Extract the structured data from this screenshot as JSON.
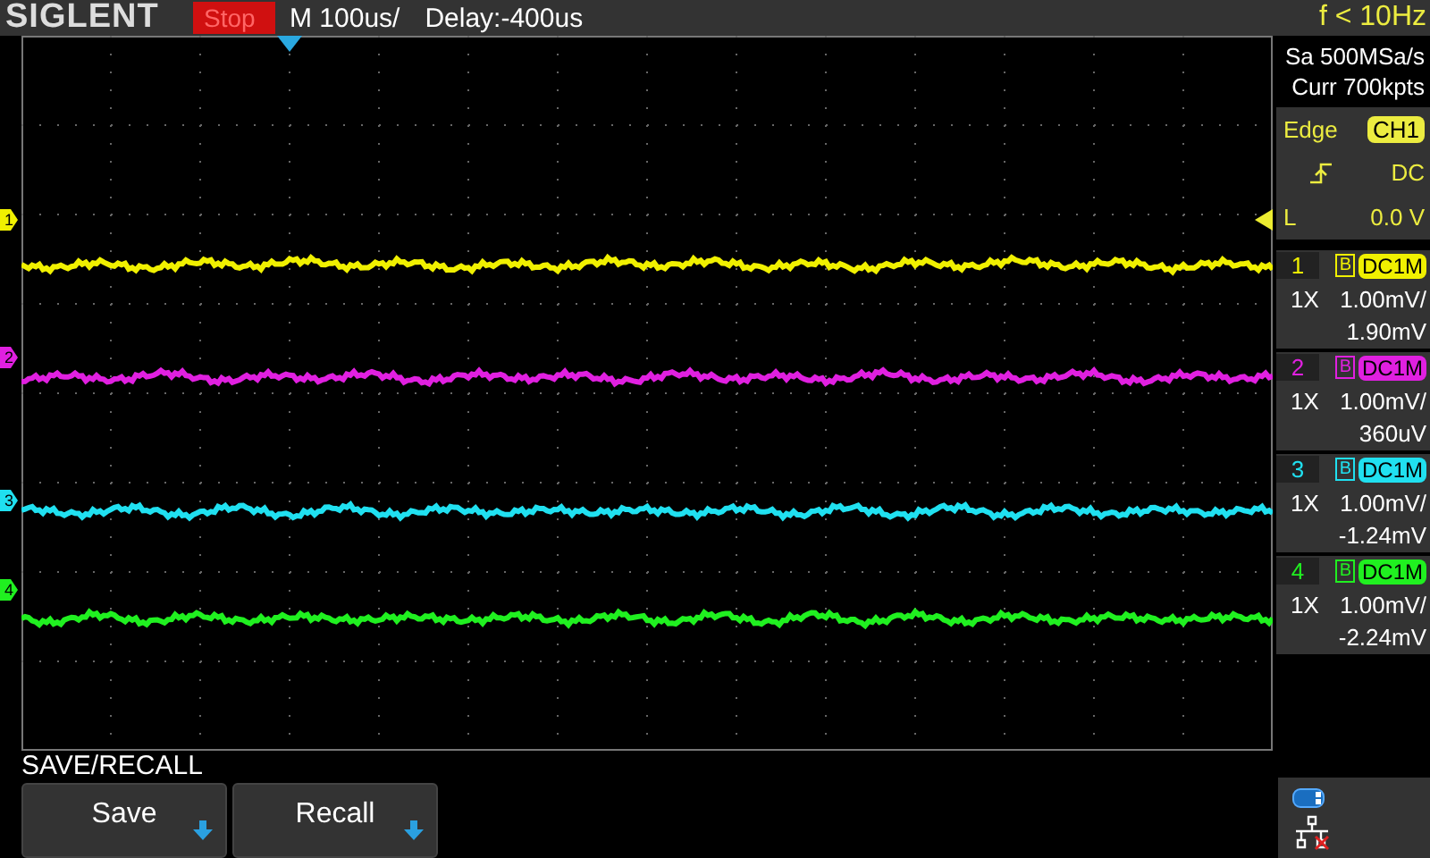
{
  "header": {
    "brand": "SIGLENT",
    "run_state": "Stop",
    "timebase": "M 100us/",
    "delay": "Delay:-400us",
    "frequency": "f < 10Hz"
  },
  "acquisition": {
    "sample_rate": "Sa 500MSa/s",
    "memory_depth": "Curr 700kpts"
  },
  "trigger": {
    "type": "Edge",
    "source": "CH1",
    "coupling": "DC",
    "level_label": "L",
    "level_value": "0.0 V"
  },
  "channels": [
    {
      "number": "1",
      "marker": "1",
      "color": "#f0f000",
      "bandwidth_mark": "B",
      "coupling": "DC1M",
      "probe": "1X",
      "scale": "1.00mV/",
      "offset": "1.90mV"
    },
    {
      "number": "2",
      "marker": "2",
      "color": "#e020e0",
      "bandwidth_mark": "B",
      "coupling": "DC1M",
      "probe": "1X",
      "scale": "1.00mV/",
      "offset": "360uV"
    },
    {
      "number": "3",
      "marker": "3",
      "color": "#20e0f0",
      "bandwidth_mark": "B",
      "coupling": "DC1M",
      "probe": "1X",
      "scale": "1.00mV/",
      "offset": "-1.24mV"
    },
    {
      "number": "4",
      "marker": "4",
      "color": "#20f020",
      "bandwidth_mark": "B",
      "coupling": "DC1M",
      "probe": "1X",
      "scale": "1.00mV/",
      "offset": "-2.24mV"
    }
  ],
  "menu": {
    "title": "SAVE/RECALL",
    "buttons": [
      {
        "label": "Save"
      },
      {
        "label": "Recall"
      }
    ]
  }
}
